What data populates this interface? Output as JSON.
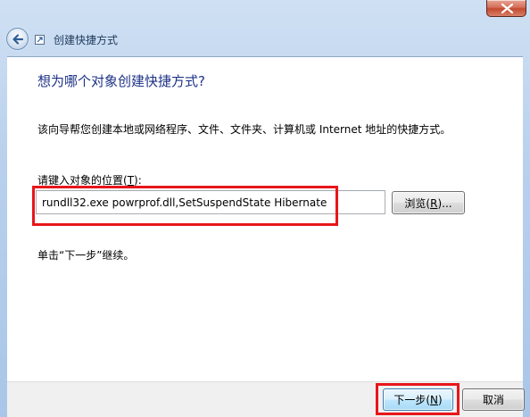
{
  "window": {
    "title": "创建快捷方式"
  },
  "wizard": {
    "heading": "想为哪个对象创建快捷方式?",
    "description": "该向导帮您创建本地或网络程序、文件、文件夹、计算机或 Internet 地址的快捷方式。",
    "location_label_pre": "请键入对象的位置(",
    "location_label_key": "T",
    "location_label_post": "):",
    "location_value": "rundll32.exe powrprof.dll,SetSuspendState Hibernate",
    "browse_pre": "浏览(",
    "browse_key": "R",
    "browse_post": ")...",
    "hint": "单击“下一步”继续。"
  },
  "buttons": {
    "next_pre": "下一步(",
    "next_key": "N",
    "next_post": ")",
    "cancel": "取消"
  },
  "colors": {
    "highlight": "#e8161b",
    "heading": "#1e3287"
  },
  "icons": {
    "close": "close-icon",
    "back": "back-arrow-icon",
    "title": "shortcut-icon"
  }
}
